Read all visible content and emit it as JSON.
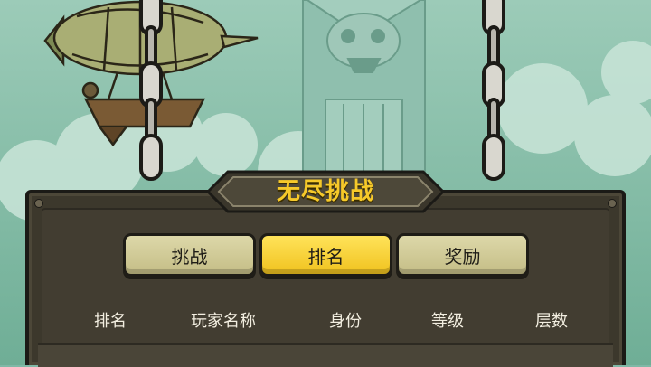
{
  "dialog": {
    "title": "无尽挑战"
  },
  "tabs": [
    {
      "label": "挑战",
      "active": false
    },
    {
      "label": "排名",
      "active": true
    },
    {
      "label": "奖励",
      "active": false
    }
  ],
  "ranking": {
    "columns": [
      "排名",
      "玩家名称",
      "身份",
      "等级",
      "层数"
    ]
  },
  "colors": {
    "active_tab": "#f0c21e",
    "inactive_tab": "#d6d1a0",
    "title_text": "#f6c92a",
    "panel": "#3c382c"
  }
}
